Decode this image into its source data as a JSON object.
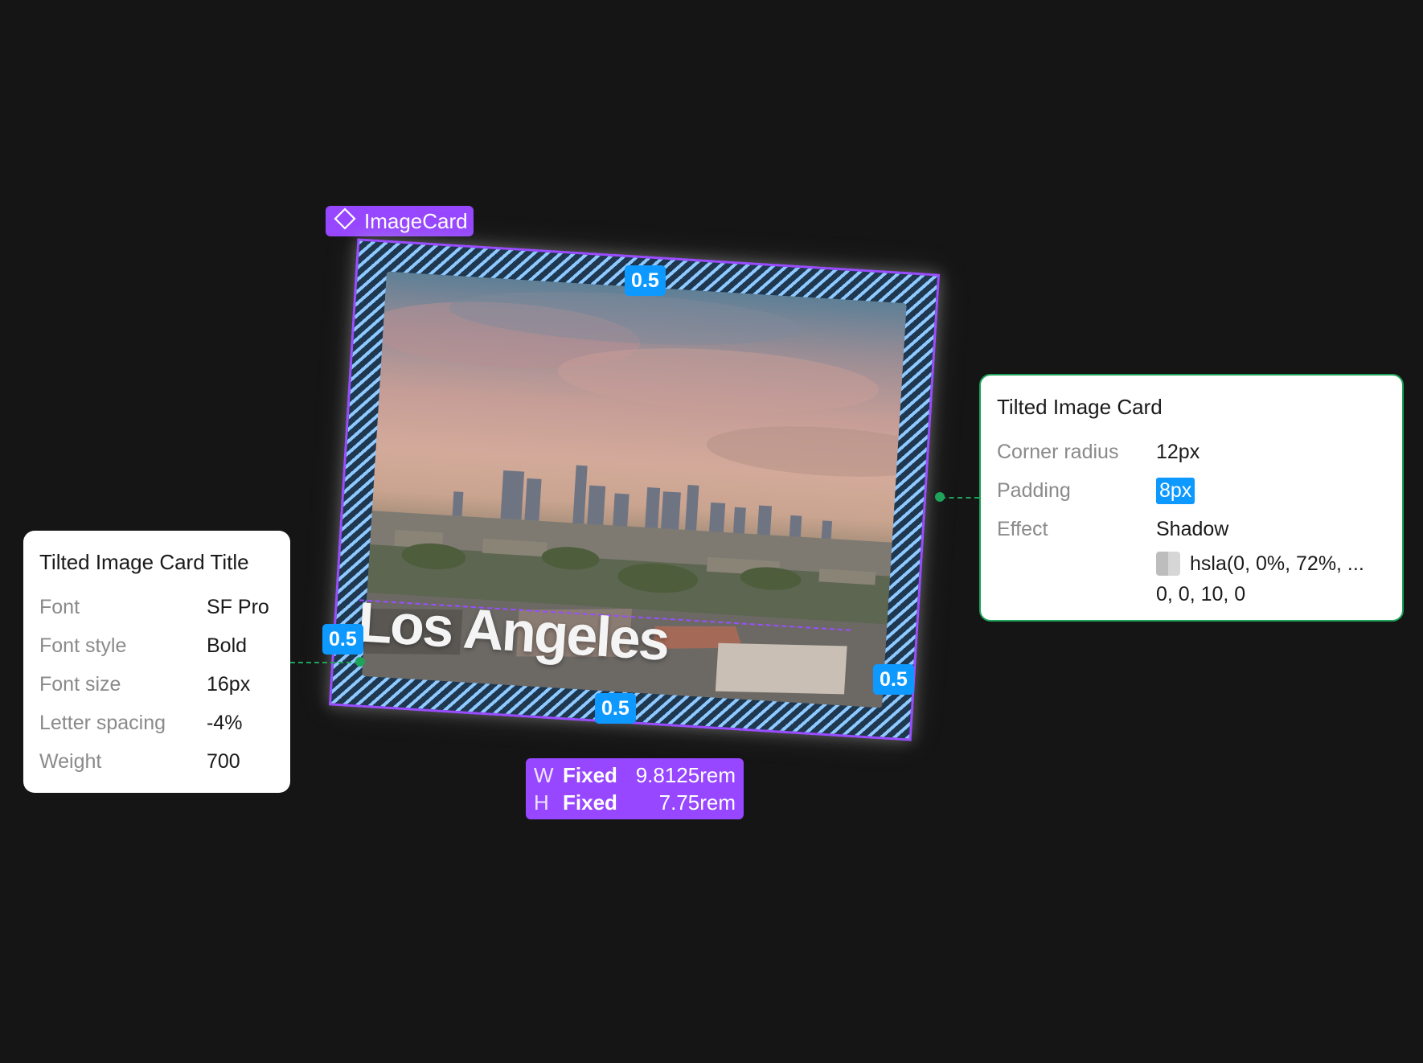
{
  "component": {
    "tag_label": "ImageCard"
  },
  "card": {
    "title": "Los Angeles"
  },
  "spacing": {
    "top": "0.5",
    "right": "0.5",
    "bottom": "0.5",
    "left": "0.5"
  },
  "dimensions": {
    "w_axis": "W",
    "w_mode": "Fixed",
    "w_value": "9.8125rem",
    "h_axis": "H",
    "h_mode": "Fixed",
    "h_value": "7.75rem"
  },
  "title_panel": {
    "title": "Tilted Image Card Title",
    "rows": [
      {
        "label": "Font",
        "value": "SF Pro"
      },
      {
        "label": "Font style",
        "value": "Bold"
      },
      {
        "label": "Font size",
        "value": "16px"
      },
      {
        "label": "Letter spacing",
        "value": "-4%"
      },
      {
        "label": "Weight",
        "value": "700"
      }
    ]
  },
  "card_panel": {
    "title": "Tilted Image Card",
    "corner_radius_label": "Corner radius",
    "corner_radius_value": "12px",
    "padding_label": "Padding",
    "padding_value": "8px",
    "effect_label": "Effect",
    "effect_value": "Shadow",
    "shadow_color": "hsla(0, 0%, 72%, ...",
    "shadow_offsets": "0, 0, 10, 0"
  },
  "colors": {
    "component": "#9747ff",
    "spacing": "#0d99ff",
    "connector": "#1fa35a",
    "canvas": "#151515"
  },
  "icons": {
    "component": "component-diamond-icon",
    "swatch": "color-swatch-icon"
  }
}
